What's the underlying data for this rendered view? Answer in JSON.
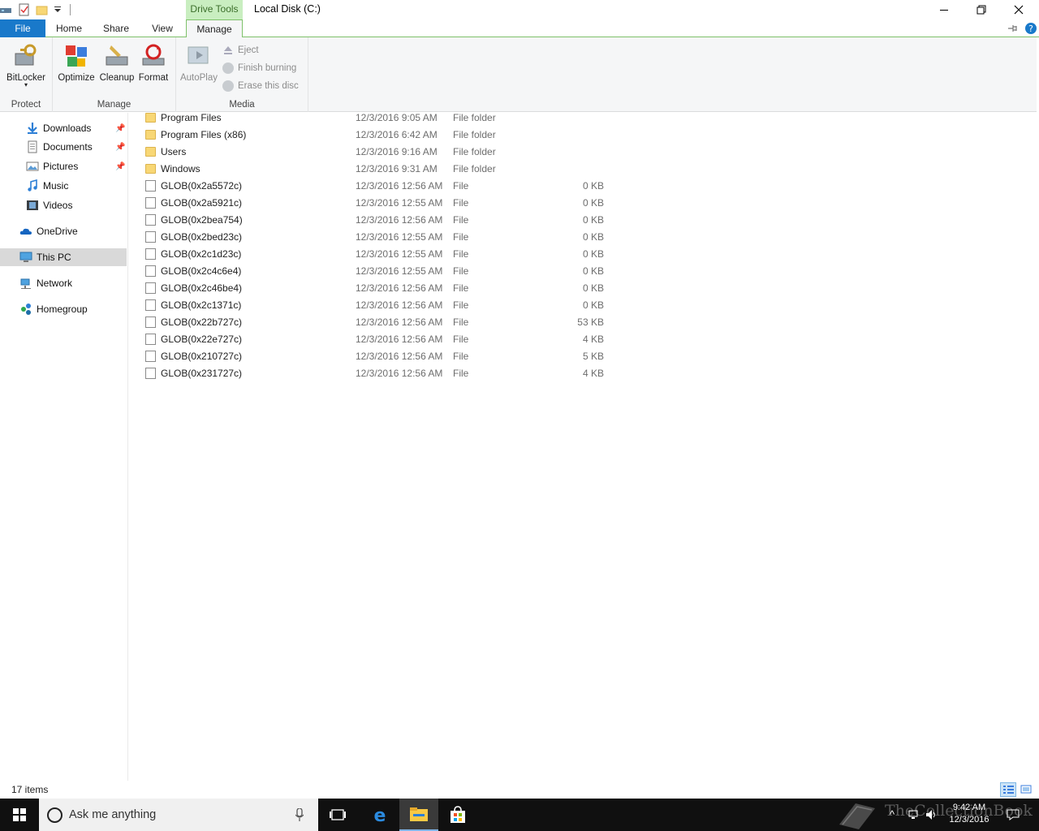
{
  "window": {
    "title": "Local Disk (C:)",
    "context_tab_group": "Drive Tools"
  },
  "tabs": {
    "file": "File",
    "home": "Home",
    "share": "Share",
    "view": "View",
    "manage": "Manage"
  },
  "ribbon": {
    "protect": {
      "label": "Protect",
      "bitlocker": "BitLocker"
    },
    "manage": {
      "label": "Manage",
      "optimize": "Optimize",
      "cleanup": "Cleanup",
      "format": "Format"
    },
    "media": {
      "label": "Media",
      "autoplay": "AutoPlay",
      "eject": "Eject",
      "finish_burning": "Finish burning",
      "erase_disc": "Erase this disc"
    }
  },
  "nav": {
    "items": [
      {
        "label": "Downloads",
        "icon": "download-arrow-icon",
        "pinned": true
      },
      {
        "label": "Documents",
        "icon": "documents-icon",
        "pinned": true
      },
      {
        "label": "Pictures",
        "icon": "pictures-icon",
        "pinned": true
      },
      {
        "label": "Music",
        "icon": "music-icon",
        "pinned": false
      },
      {
        "label": "Videos",
        "icon": "videos-icon",
        "pinned": false
      },
      {
        "label": "OneDrive",
        "icon": "onedrive-cloud-icon",
        "pinned": false
      },
      {
        "label": "This PC",
        "icon": "this-pc-monitor-icon",
        "pinned": false,
        "selected": true
      },
      {
        "label": "Network",
        "icon": "network-icon",
        "pinned": false
      },
      {
        "label": "Homegroup",
        "icon": "homegroup-icon",
        "pinned": false
      }
    ]
  },
  "files": [
    {
      "name": "Program Files",
      "date": "12/3/2016 9:05 AM",
      "type": "File folder",
      "size": "",
      "kind": "folder"
    },
    {
      "name": "Program Files (x86)",
      "date": "12/3/2016 6:42 AM",
      "type": "File folder",
      "size": "",
      "kind": "folder"
    },
    {
      "name": "Users",
      "date": "12/3/2016 9:16 AM",
      "type": "File folder",
      "size": "",
      "kind": "folder"
    },
    {
      "name": "Windows",
      "date": "12/3/2016 9:31 AM",
      "type": "File folder",
      "size": "",
      "kind": "folder"
    },
    {
      "name": "GLOB(0x2a5572c)",
      "date": "12/3/2016 12:56 AM",
      "type": "File",
      "size": "0 KB",
      "kind": "file"
    },
    {
      "name": "GLOB(0x2a5921c)",
      "date": "12/3/2016 12:55 AM",
      "type": "File",
      "size": "0 KB",
      "kind": "file"
    },
    {
      "name": "GLOB(0x2bea754)",
      "date": "12/3/2016 12:56 AM",
      "type": "File",
      "size": "0 KB",
      "kind": "file"
    },
    {
      "name": "GLOB(0x2bed23c)",
      "date": "12/3/2016 12:55 AM",
      "type": "File",
      "size": "0 KB",
      "kind": "file"
    },
    {
      "name": "GLOB(0x2c1d23c)",
      "date": "12/3/2016 12:55 AM",
      "type": "File",
      "size": "0 KB",
      "kind": "file"
    },
    {
      "name": "GLOB(0x2c4c6e4)",
      "date": "12/3/2016 12:55 AM",
      "type": "File",
      "size": "0 KB",
      "kind": "file"
    },
    {
      "name": "GLOB(0x2c46be4)",
      "date": "12/3/2016 12:56 AM",
      "type": "File",
      "size": "0 KB",
      "kind": "file"
    },
    {
      "name": "GLOB(0x2c1371c)",
      "date": "12/3/2016 12:56 AM",
      "type": "File",
      "size": "0 KB",
      "kind": "file"
    },
    {
      "name": "GLOB(0x22b727c)",
      "date": "12/3/2016 12:56 AM",
      "type": "File",
      "size": "53 KB",
      "kind": "file"
    },
    {
      "name": "GLOB(0x22e727c)",
      "date": "12/3/2016 12:56 AM",
      "type": "File",
      "size": "4 KB",
      "kind": "file"
    },
    {
      "name": "GLOB(0x210727c)",
      "date": "12/3/2016 12:56 AM",
      "type": "File",
      "size": "5 KB",
      "kind": "file"
    },
    {
      "name": "GLOB(0x231727c)",
      "date": "12/3/2016 12:56 AM",
      "type": "File",
      "size": "4 KB",
      "kind": "file"
    }
  ],
  "status": {
    "count": "17 items"
  },
  "taskbar": {
    "search_placeholder": "Ask me anything",
    "time": "9:42 AM",
    "date": "12/3/2016",
    "watermark": "TheCollectionBook"
  },
  "colors": {
    "accent": "#1979ca",
    "context_tab": "#c9eec0",
    "taskbar": "#101010",
    "folder": "#f8d775"
  }
}
